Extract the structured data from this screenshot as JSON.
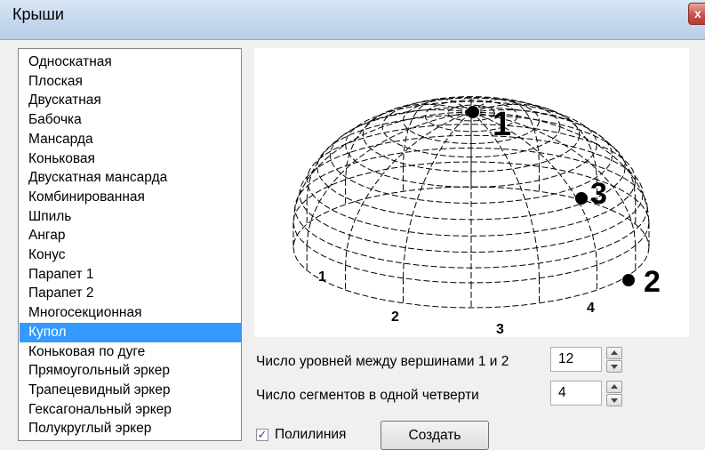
{
  "window": {
    "title": "Крыши",
    "close_glyph": "x"
  },
  "roof_list": {
    "items": [
      "Односкатная",
      "Плоская",
      "Двускатная",
      "Бабочка",
      "Мансарда",
      "Коньковая",
      "Двускатная мансарда",
      "Комбинированная",
      "Шпиль",
      "Ангар",
      "Конус",
      "Парапет 1",
      "Парапет 2",
      "Многосекционная",
      "Купол",
      "Коньковая по дуге",
      "Прямоугольный эркер",
      "Трапецевидный эркер",
      "Гексагональный эркер",
      "Полукруглый эркер"
    ],
    "selected_index": 14
  },
  "preview": {
    "point_labels": [
      "1",
      "3",
      "2"
    ],
    "quarter_labels": [
      "1",
      "2",
      "3",
      "4"
    ],
    "line_color": "#000000"
  },
  "params": {
    "levels_label": "Число уровней между вершинами 1 и 2",
    "levels_value": "12",
    "segments_label": "Число сегментов в одной четверти",
    "segments_value": "4"
  },
  "polyline": {
    "label": "Полилиния",
    "checked": true,
    "check_glyph": "✓"
  },
  "create_button": {
    "label": "Создать"
  },
  "colors": {
    "selection": "#3399ff",
    "title_bar": "#c5d8ee"
  },
  "icons": {
    "close": "close-icon",
    "spin_up": "arrow-up-icon",
    "spin_down": "arrow-down-icon"
  }
}
